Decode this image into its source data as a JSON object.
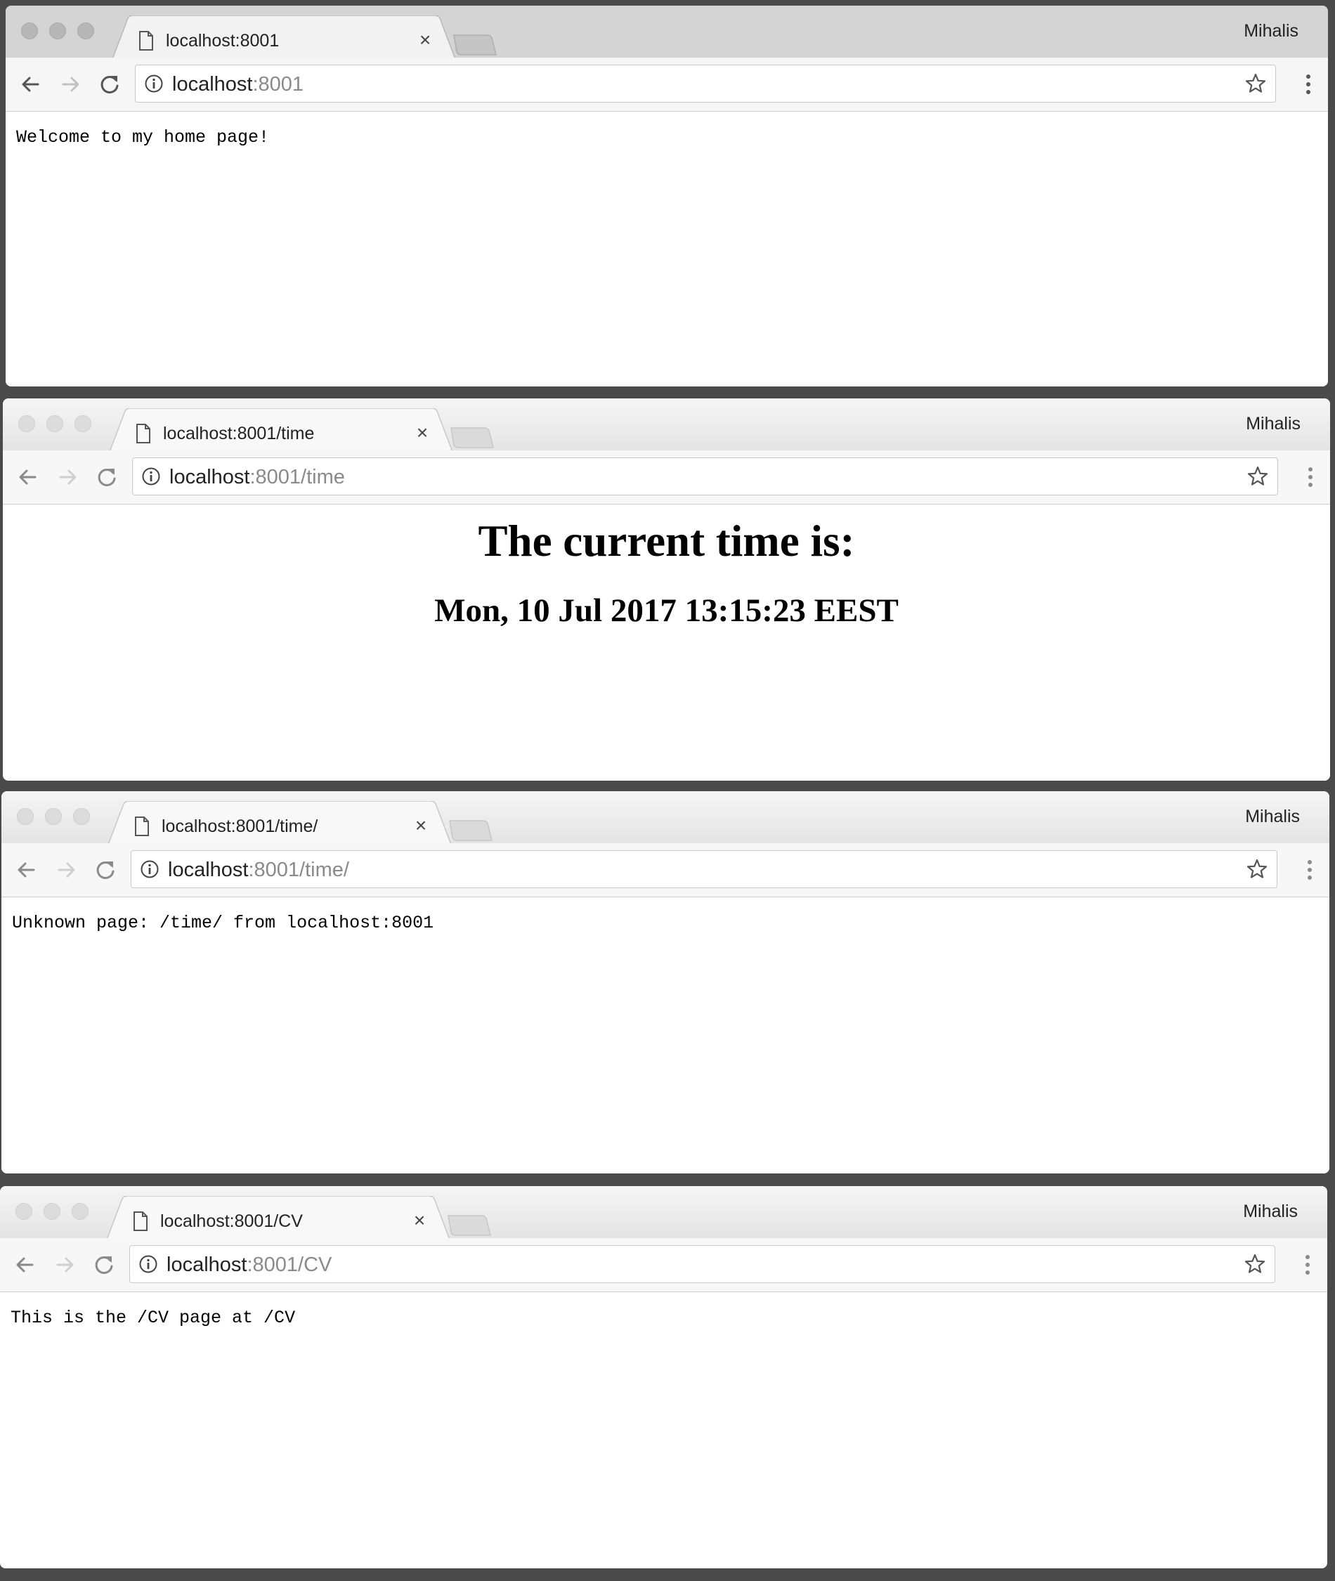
{
  "windows": [
    {
      "tab_title": "localhost:8001",
      "profile": "Mihalis",
      "url_host": "localhost",
      "url_rest": ":8001",
      "content_text": "Welcome to my home page!",
      "active": true
    },
    {
      "tab_title": "localhost:8001/time",
      "profile": "Mihalis",
      "url_host": "localhost",
      "url_rest": ":8001/time",
      "heading": "The current time is:",
      "time_value": "Mon, 10 Jul 2017 13:15:23 EEST",
      "active": false
    },
    {
      "tab_title": "localhost:8001/time/",
      "profile": "Mihalis",
      "url_host": "localhost",
      "url_rest": ":8001/time/",
      "content_text": "Unknown page: /time/ from localhost:8001",
      "active": false
    },
    {
      "tab_title": "localhost:8001/CV",
      "profile": "Mihalis",
      "url_host": "localhost",
      "url_rest": ":8001/CV",
      "content_text": "This is the /CV page at /CV",
      "active": false
    }
  ],
  "icons": {
    "tab": "file-icon",
    "close": "close-icon",
    "back": "back-arrow-icon",
    "forward": "forward-arrow-icon",
    "reload": "reload-icon",
    "site_info": "info-icon",
    "bookmark": "star-icon",
    "menu": "kebab-menu-icon"
  },
  "colors": {
    "desktop": "#4a4a4a",
    "active_tabbar": "#d4d4d4",
    "inactive_tabbar": "#ebebeb",
    "url_rest": "#8a8a8a"
  }
}
